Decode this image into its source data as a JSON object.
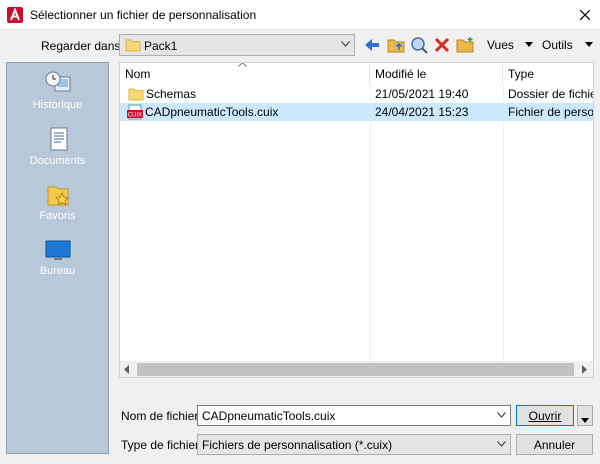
{
  "window": {
    "title": "Sélectionner un fichier de personnalisation"
  },
  "lookin": {
    "label": "Regarder dans:",
    "value": "Pack1"
  },
  "toolbar": {
    "views_label": "Vues",
    "tools_label": "Outils"
  },
  "places": [
    {
      "label": "Historique",
      "icon": "history-icon"
    },
    {
      "label": "Documents",
      "icon": "documents-icon"
    },
    {
      "label": "Favoris",
      "icon": "favorites-icon"
    },
    {
      "label": "Bureau",
      "icon": "desktop-icon"
    }
  ],
  "filelist": {
    "columns": [
      "Nom",
      "Modifié le",
      "Type"
    ],
    "rows": [
      {
        "name": "Schemas",
        "modified": "21/05/2021 19:40",
        "type": "Dossier de fichiers",
        "icon": "folder-icon",
        "selected": false
      },
      {
        "name": "CADpneumaticTools.cuix",
        "modified": "24/04/2021 15:23",
        "type": "Fichier de personn",
        "icon": "cuix-file-icon",
        "selected": true
      }
    ]
  },
  "filename": {
    "label": "Nom de fichier:",
    "value": "CADpneumaticTools.cuix"
  },
  "filetype": {
    "label": "Type de fichier:",
    "value": "Fichiers de personnalisation (*.cuix)"
  },
  "buttons": {
    "open": "Ouvrir",
    "cancel": "Annuler"
  },
  "colors": {
    "places_bg": "#b7c8d9",
    "selection": "#cce8ff",
    "brand_red": "#c8102e"
  }
}
